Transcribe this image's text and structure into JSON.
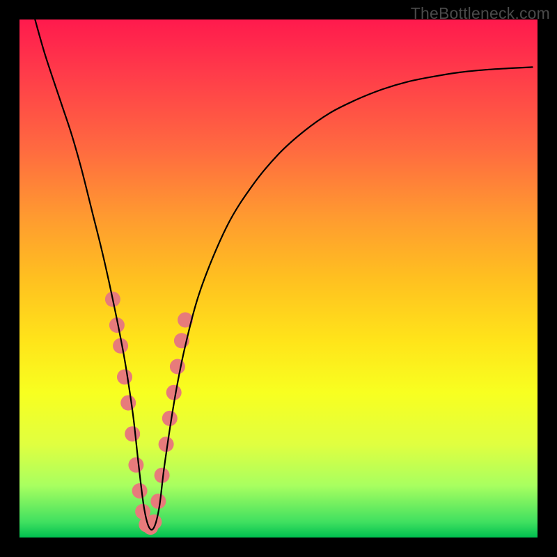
{
  "watermark": "TheBottleneck.com",
  "chart_data": {
    "type": "line",
    "title": "",
    "xlabel": "",
    "ylabel": "",
    "xlim": [
      0,
      100
    ],
    "ylim": [
      0,
      100
    ],
    "grid": false,
    "legend": false,
    "series": [
      {
        "name": "bottleneck-curve",
        "x": [
          3,
          5,
          8,
          10,
          12,
          14,
          16,
          18,
          20,
          21,
          22,
          23,
          24,
          25,
          26,
          27,
          28,
          30,
          32,
          35,
          40,
          45,
          50,
          55,
          60,
          65,
          70,
          75,
          80,
          85,
          90,
          95,
          99
        ],
        "y": [
          100,
          93,
          84,
          78,
          71,
          63,
          55,
          46,
          36,
          30,
          23,
          14,
          6,
          2,
          2,
          6,
          14,
          27,
          37,
          48,
          60,
          68,
          74,
          78.5,
          82,
          84.5,
          86.5,
          88,
          89,
          89.8,
          90.3,
          90.6,
          90.8
        ],
        "color": "#000000",
        "linewidth": 2.2
      }
    ],
    "markers": {
      "name": "highlight-dots",
      "color": "#e77b7b",
      "radius": 11,
      "points": [
        {
          "x": 18.0,
          "y": 46
        },
        {
          "x": 18.8,
          "y": 41
        },
        {
          "x": 19.5,
          "y": 37
        },
        {
          "x": 20.3,
          "y": 31
        },
        {
          "x": 21.0,
          "y": 26
        },
        {
          "x": 21.8,
          "y": 20
        },
        {
          "x": 22.5,
          "y": 14
        },
        {
          "x": 23.2,
          "y": 9
        },
        {
          "x": 23.8,
          "y": 5
        },
        {
          "x": 24.5,
          "y": 2.5
        },
        {
          "x": 25.3,
          "y": 2
        },
        {
          "x": 26.0,
          "y": 3
        },
        {
          "x": 26.8,
          "y": 7
        },
        {
          "x": 27.5,
          "y": 12
        },
        {
          "x": 28.3,
          "y": 18
        },
        {
          "x": 29.0,
          "y": 23
        },
        {
          "x": 29.8,
          "y": 28
        },
        {
          "x": 30.5,
          "y": 33
        },
        {
          "x": 31.3,
          "y": 38
        },
        {
          "x": 32.0,
          "y": 42
        }
      ]
    }
  }
}
